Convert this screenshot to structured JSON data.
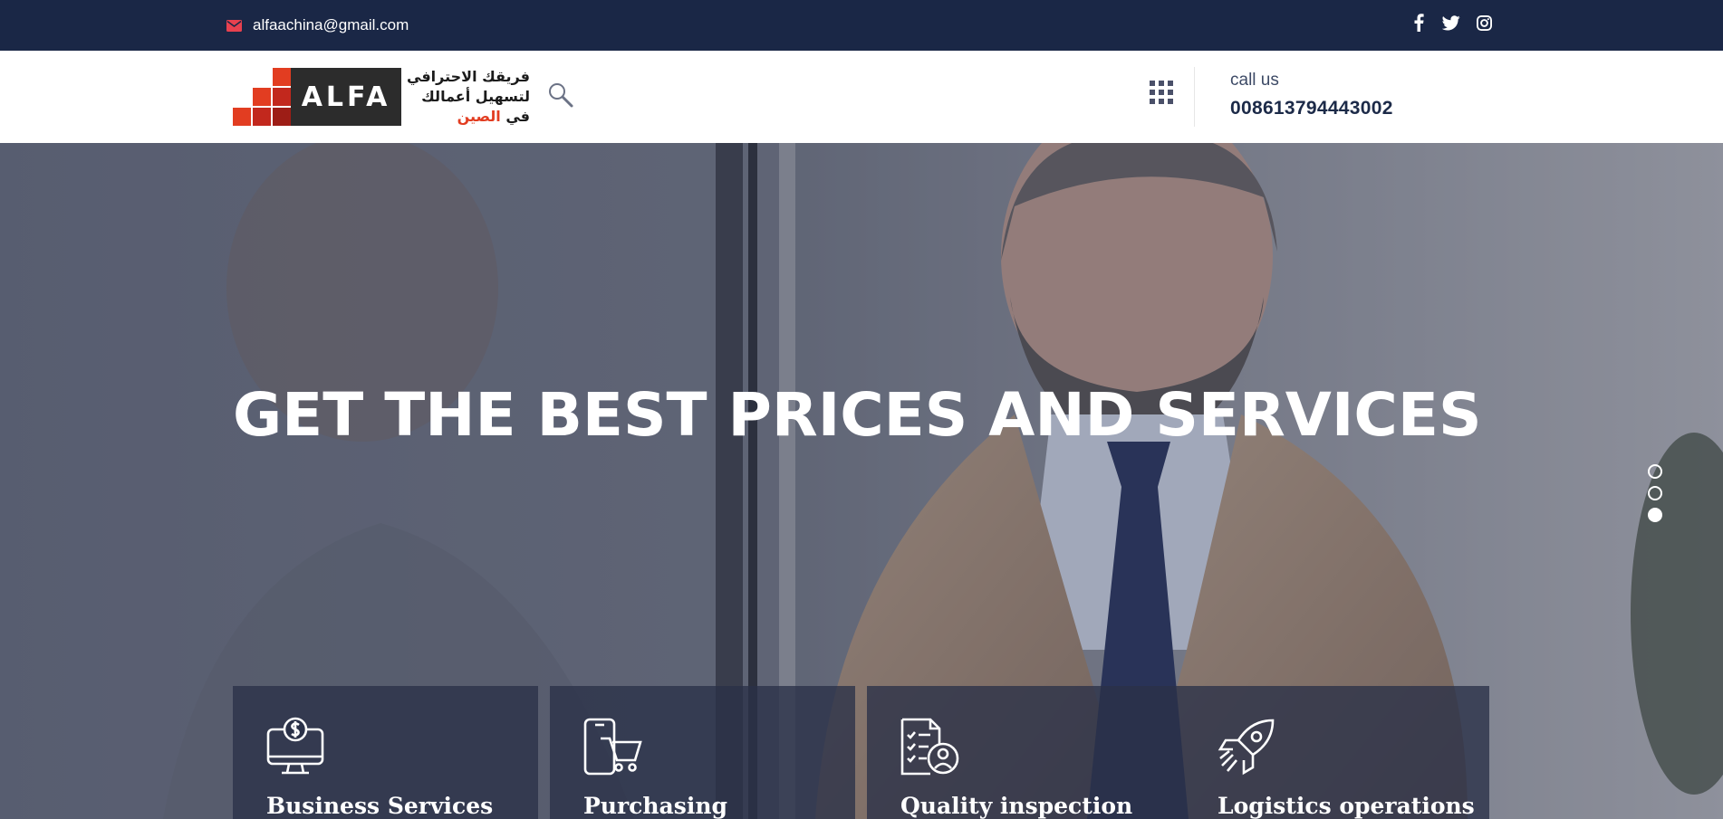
{
  "topbar": {
    "email": "alfaachina@gmail.com",
    "icons": [
      "envelope-icon",
      "facebook-icon",
      "twitter-icon",
      "instagram-icon"
    ]
  },
  "header": {
    "logo_word": "ALFA",
    "tagline_line1": "فريقك الاحترافي",
    "tagline_line2": "لتسهيل أعمالك",
    "tagline_line3_prefix": "في ",
    "tagline_line3_highlight": "الصين",
    "call_label": "call us",
    "call_number": "008613794443002"
  },
  "hero": {
    "headline": "GET THE BEST PRICES AND SERVICES",
    "slides": {
      "count": 3,
      "active_index": 2
    }
  },
  "services": [
    {
      "title": "Business Services",
      "icon": "monitor-dollar-icon"
    },
    {
      "title": "Purchasing",
      "icon": "mobile-cart-icon"
    },
    {
      "title": "Quality inspection",
      "icon": "checklist-inspector-icon"
    },
    {
      "title": "Logistics operations",
      "icon": "rocket-icon"
    }
  ],
  "colors": {
    "topbar_bg": "#1a2746",
    "accent_red": "#e23d21",
    "text_dark": "#1c2a48",
    "card_bg": "#2a3148"
  }
}
